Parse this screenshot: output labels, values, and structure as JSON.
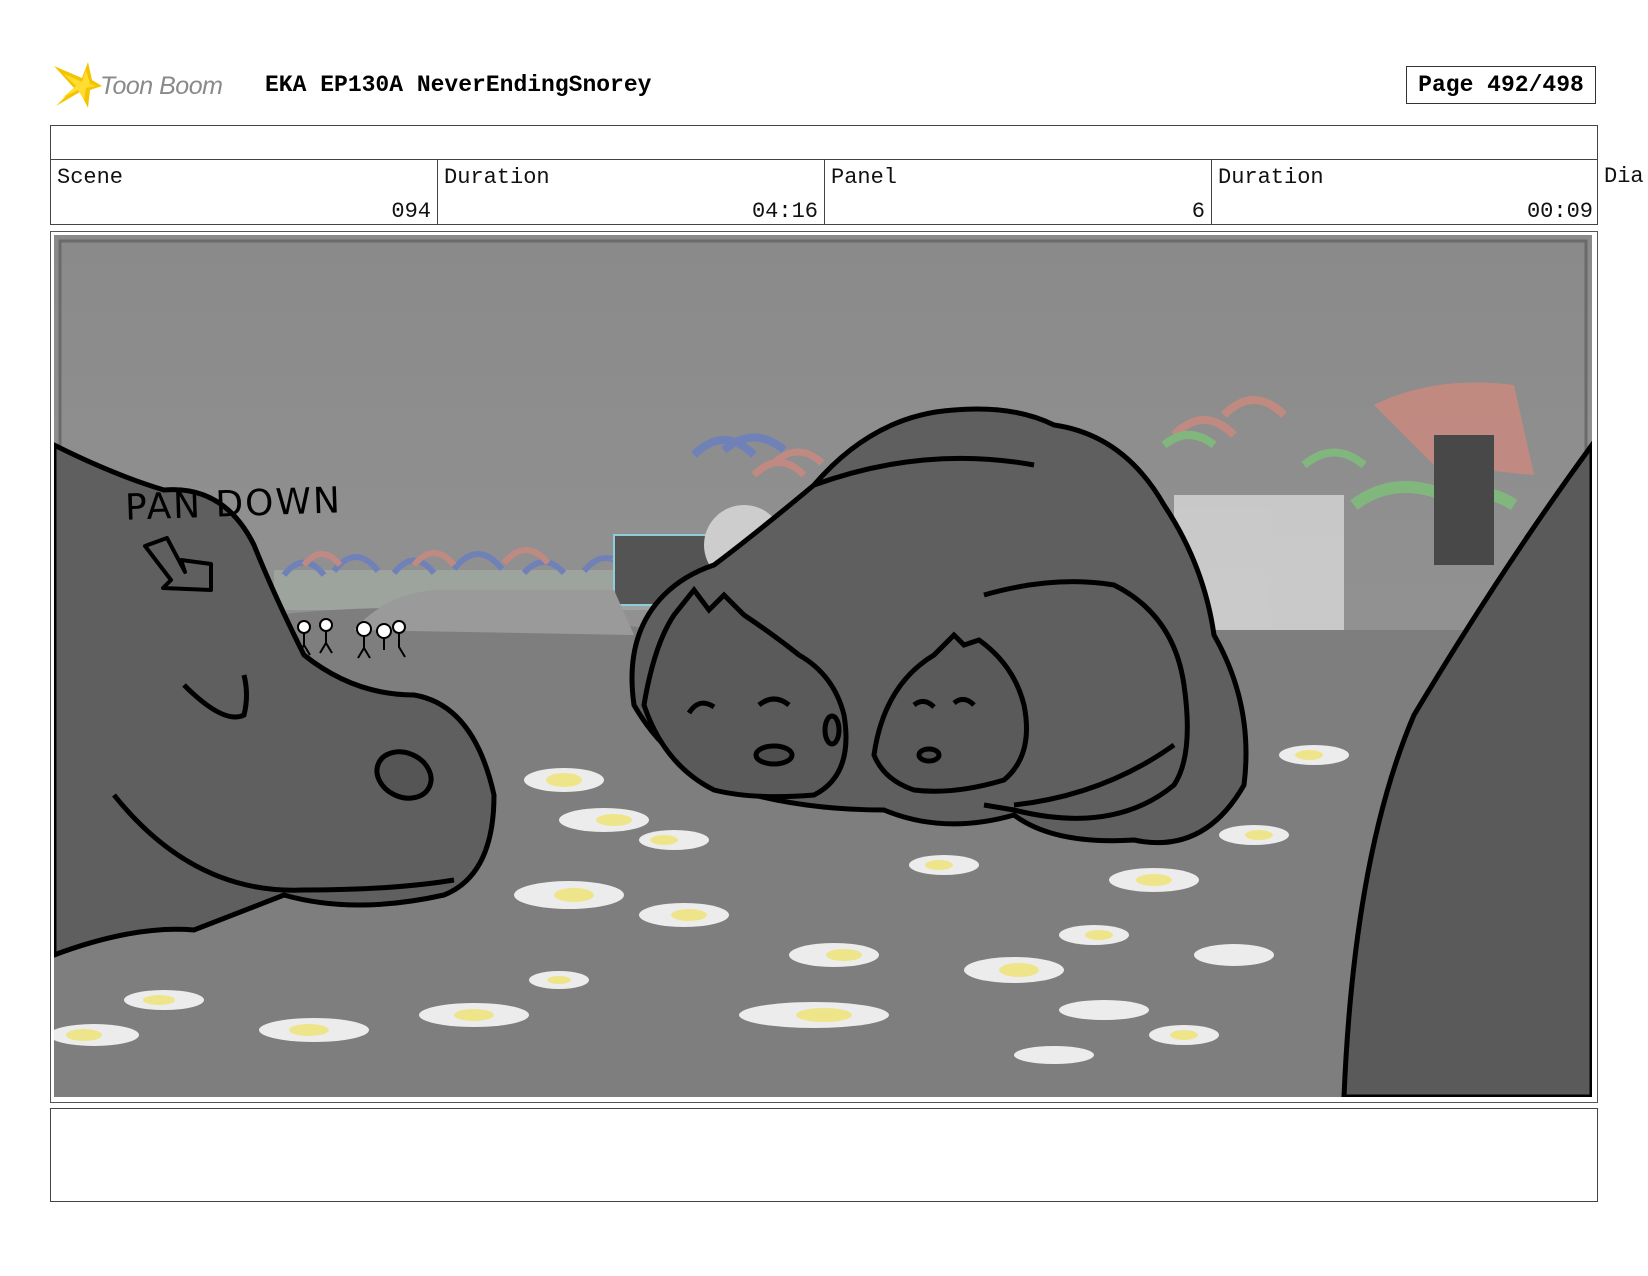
{
  "header": {
    "logo_text": "Toon Boom",
    "project_title": "EKA EP130A NeverEndingSnorey",
    "page_number": "Page 492/498"
  },
  "info_table": {
    "scene_label": "Scene",
    "scene_value": "094",
    "scene_duration_label": "Duration",
    "scene_duration_value": "04:16",
    "panel_label": "Panel",
    "panel_value": "6",
    "panel_duration_label": "Duration",
    "panel_duration_value": "00:09",
    "cut_off_label": "Dia"
  },
  "panel": {
    "note": "PAN DOWN"
  },
  "colors": {
    "logo_yellow": "#f5c400",
    "sky_gray": "#8e8e8e",
    "ground_gray": "#7d7d7d",
    "dino_gray": "#5e5e5e",
    "flower_white": "#ececec",
    "flower_yellow": "#eee58a"
  }
}
